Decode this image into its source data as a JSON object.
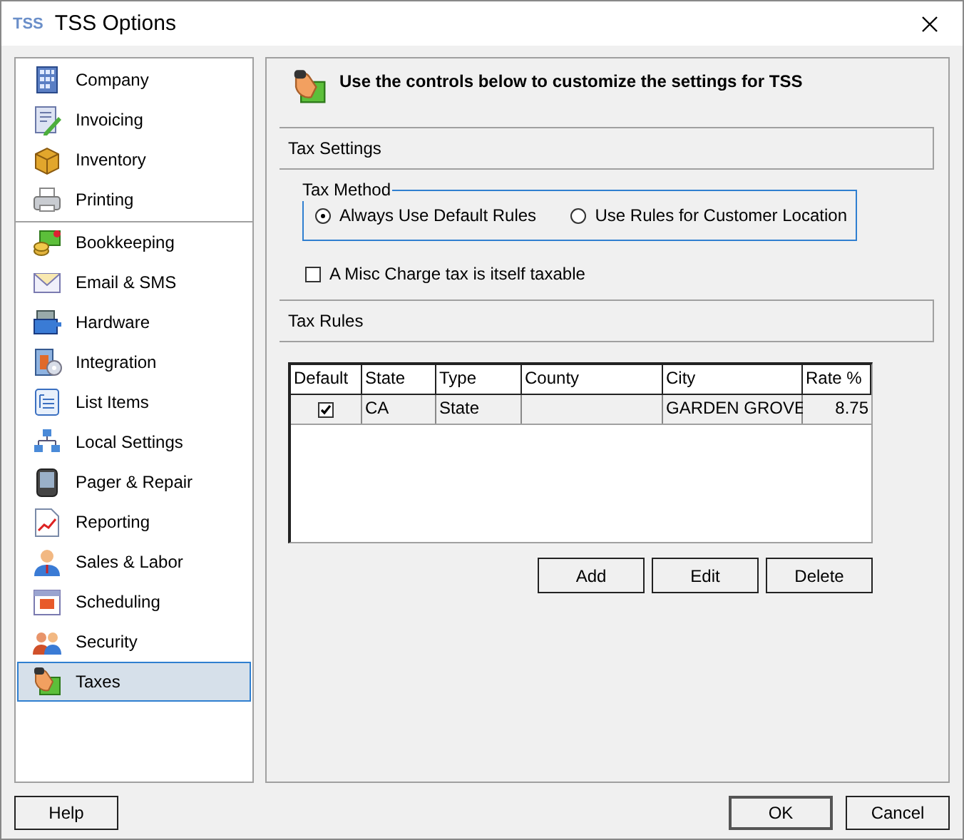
{
  "window": {
    "logo": "TSS",
    "title": "TSS Options"
  },
  "sidebar": {
    "groups": [
      [
        {
          "label": "Company",
          "selected": false
        },
        {
          "label": "Invoicing",
          "selected": false
        },
        {
          "label": "Inventory",
          "selected": false
        },
        {
          "label": "Printing",
          "selected": false
        }
      ],
      [
        {
          "label": "Bookkeeping",
          "selected": false
        },
        {
          "label": "Email & SMS",
          "selected": false
        },
        {
          "label": "Hardware",
          "selected": false
        },
        {
          "label": "Integration",
          "selected": false
        },
        {
          "label": "List Items",
          "selected": false
        },
        {
          "label": "Local Settings",
          "selected": false
        },
        {
          "label": "Pager & Repair",
          "selected": false
        },
        {
          "label": "Reporting",
          "selected": false
        },
        {
          "label": "Sales & Labor",
          "selected": false
        },
        {
          "label": "Scheduling",
          "selected": false
        },
        {
          "label": "Security",
          "selected": false
        },
        {
          "label": "Taxes",
          "selected": true
        }
      ]
    ]
  },
  "header": "Use the controls below to customize the settings for TSS",
  "tax_settings": {
    "title": "Tax Settings",
    "tax_method": {
      "legend": "Tax Method",
      "options": [
        {
          "label": "Always Use Default Rules",
          "selected": true
        },
        {
          "label": "Use Rules for Customer Location",
          "selected": false
        }
      ]
    },
    "misc_taxable": {
      "label": "A Misc Charge tax is itself taxable",
      "checked": false
    }
  },
  "tax_rules": {
    "title": "Tax Rules",
    "columns": [
      "Default",
      "State",
      "Type",
      "County",
      "City",
      "Rate %"
    ],
    "rows": [
      {
        "default": true,
        "state": "CA",
        "type": "State",
        "county": "",
        "city": "GARDEN GROVE",
        "rate": "8.75"
      }
    ],
    "buttons": [
      "Add",
      "Edit",
      "Delete"
    ]
  },
  "footer": {
    "help": "Help",
    "ok": "OK",
    "cancel": "Cancel"
  }
}
